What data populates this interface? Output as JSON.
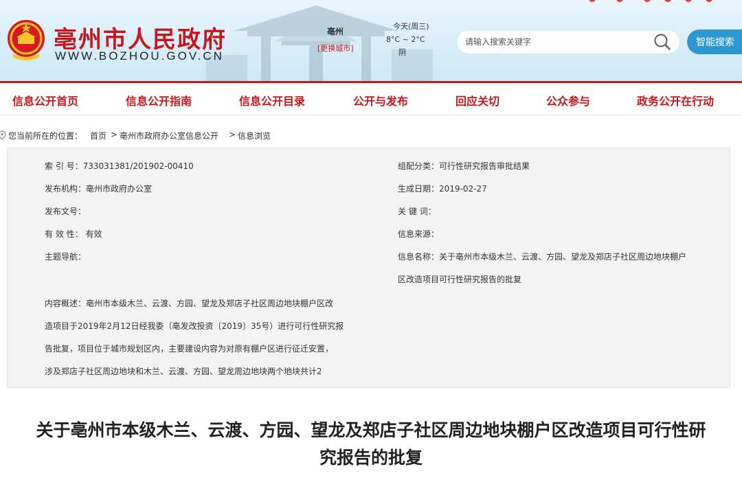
{
  "header": {
    "site_title": "亳州市人民政府",
    "site_url": "WWW.BOZHOU.GOV.CN",
    "city": "亳州",
    "change_city": "[更换城市]",
    "weather_day": "今天(周三)",
    "weather_temp": "8°C ~ 2°C",
    "weather_cond": "阴",
    "search_placeholder": "请输入搜索关键字",
    "smart_search_label": "智能搜索"
  },
  "nav": {
    "items": [
      "信息公开首页",
      "信息公开指南",
      "信息公开目录",
      "公开与发布",
      "回应关切",
      "公众参与",
      "政务公开在行动"
    ]
  },
  "breadcrumb": {
    "prefix": "您当前所在的位置：",
    "home": "首页",
    "sep1": ">",
    "section": "亳州市政府办公室信息公开",
    "sep2": ">",
    "current": "信息浏览"
  },
  "info": {
    "index_no": "索 引 号：733031381/201902-00410",
    "category": "组配分类：可行性研究报告审批结果",
    "publisher": "发布机构：亳州市政府办公室",
    "date": "生成日期：2019-02-27",
    "doc_no": "发布文号：",
    "keywords": "关 键 词：",
    "validity": "有 效 性： 有效",
    "source": "信息来源：",
    "topic": "主题导航：",
    "name_line1": "信息名称：关于亳州市本级木兰、云渡、方园、望龙及郑店子社区周边地块棚户",
    "name_line2": "区改造项目可行性研究报告的批复",
    "summary": [
      "内容概述：亳州市本级木兰、云渡、方园、望龙及郑店子社区周边地块棚户区改",
      "造项目于2019年2月12日经我委（亳发改投资〔2019〕35号）进行可行性研究报",
      "告批复，项目位于城市规划区内，主要建设内容为对原有棚户区进行征迁安置，",
      "涉及郑店子社区周边地块和木兰、云渡、方园、望龙周边地块两个地块共计2"
    ]
  },
  "article": {
    "title_line1": "关于亳州市本级木兰、云渡、方园、望龙及郑店子社区周边地块棚户区改造项目可行性研",
    "title_line2": "究报告的批复"
  },
  "colors": {
    "brand_red": "#c8161d",
    "search_blue": "#2c98d2",
    "info_bg": "#f3f3f3"
  },
  "icons": {
    "emblem": "national-emblem-icon",
    "search": "search-icon",
    "location": "location-pin-icon"
  }
}
